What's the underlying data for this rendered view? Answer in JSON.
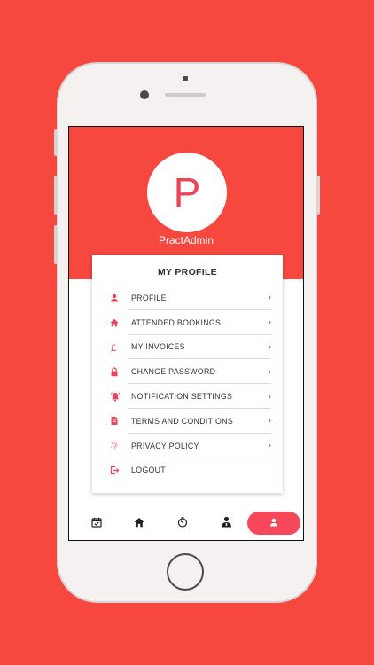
{
  "colors": {
    "background": "#f6483f",
    "header": "#f6483f",
    "accent": "#ee4458",
    "nav_active": "#f6485a"
  },
  "profile": {
    "avatar_letter": "P",
    "username": "PractAdmin"
  },
  "card": {
    "title": "MY PROFILE",
    "items": [
      {
        "label": "PROFILE",
        "icon": "person-icon",
        "chevron": "›"
      },
      {
        "label": "ATTENDED BOOKINGS",
        "icon": "home-icon",
        "chevron": "›"
      },
      {
        "label": "MY INVOICES",
        "icon": "pound-icon",
        "chevron": "›"
      },
      {
        "label": "CHANGE PASSWORD",
        "icon": "lock-icon",
        "chevron": "›"
      },
      {
        "label": "NOTIFICATION SETTINGS",
        "icon": "bell-icon",
        "chevron": "›"
      },
      {
        "label": "TERMS AND CONDITIONS",
        "icon": "document-icon",
        "chevron": "›"
      },
      {
        "label": "PRIVACY POLICY",
        "icon": "fingerprint-icon",
        "chevron": "›"
      },
      {
        "label": "LOGOUT",
        "icon": "logout-icon",
        "chevron": ""
      }
    ]
  },
  "bottom_nav": {
    "items": [
      {
        "icon": "calendar-check-icon"
      },
      {
        "icon": "home-icon"
      },
      {
        "icon": "timer-icon"
      },
      {
        "icon": "practitioner-icon"
      },
      {
        "icon": "person-icon",
        "active": true
      }
    ]
  }
}
